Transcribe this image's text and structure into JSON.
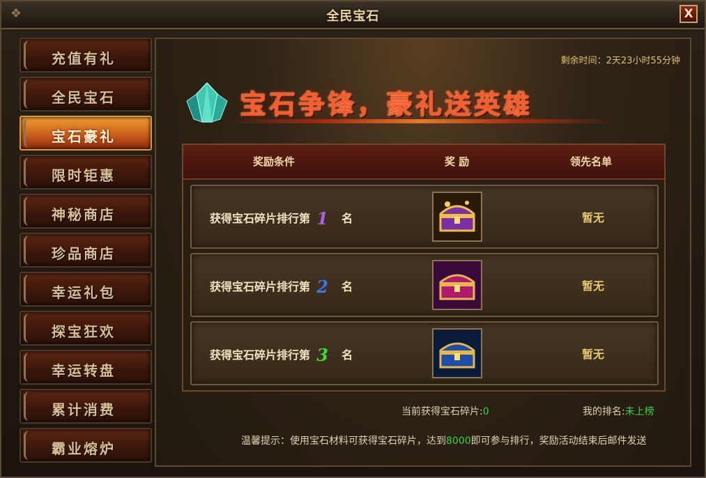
{
  "window": {
    "title": "全民宝石",
    "close_label": "X"
  },
  "sidebar": {
    "items": [
      {
        "label": "充值有礼",
        "active": false
      },
      {
        "label": "全民宝石",
        "active": false
      },
      {
        "label": "宝石豪礼",
        "active": true
      },
      {
        "label": "限时钜惠",
        "active": false
      },
      {
        "label": "神秘商店",
        "active": false
      },
      {
        "label": "珍品商店",
        "active": false
      },
      {
        "label": "幸运礼包",
        "active": false
      },
      {
        "label": "探宝狂欢",
        "active": false
      },
      {
        "label": "幸运转盘",
        "active": false
      },
      {
        "label": "累计消费",
        "active": false
      },
      {
        "label": "霸业熔炉",
        "active": false
      }
    ]
  },
  "content": {
    "timer": "剩余时间：2天23小时55分钟",
    "banner_text": "宝石争锋，豪礼送英雄",
    "table": {
      "headers": [
        "奖励条件",
        "奖 励",
        "领先名单"
      ],
      "rows": [
        {
          "condition": "获得宝石碎片排行第",
          "rank": "1",
          "unit": "名",
          "rank_color": "#b05ee8",
          "chest": "gold-purple-chest-icon",
          "leader": "暂无"
        },
        {
          "condition": "获得宝石碎片排行第",
          "rank": "2",
          "unit": "名",
          "rank_color": "#3a78e8",
          "chest": "purple-chest-icon",
          "leader": "暂无"
        },
        {
          "condition": "获得宝石碎片排行第",
          "rank": "3",
          "unit": "名",
          "rank_color": "#3ed83e",
          "chest": "blue-chest-icon",
          "leader": "暂无"
        }
      ]
    },
    "footer": {
      "fragments_label": "当前获得宝石碎片:",
      "fragments_value": "0",
      "rank_label": "我的排名:",
      "rank_value": "未上榜",
      "tip_prefix": "温馨提示：使用宝石材料可获得宝石碎片，达到",
      "tip_threshold": "8000",
      "tip_suffix": "即可参与排行，奖励活动结束后邮件发送"
    }
  },
  "colors": {
    "accent_gold": "#e0c070",
    "active_tab": "#e08a26",
    "value_green": "#3fd23f"
  }
}
